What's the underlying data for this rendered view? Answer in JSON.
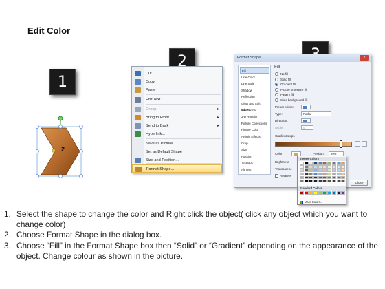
{
  "title": "Edit Color",
  "badges": [
    "1",
    "2",
    "3"
  ],
  "shape": {
    "label": "2",
    "fill": "#b4692b"
  },
  "context_menu": {
    "items": [
      {
        "label": "Cut",
        "icon": "scissors-icon",
        "color": "#3d6fb4",
        "arrow": "",
        "disabled": false,
        "highlight": false
      },
      {
        "label": "Copy",
        "icon": "copy-icon",
        "color": "#5d87c4",
        "arrow": "",
        "disabled": false,
        "highlight": false
      },
      {
        "label": "Paste",
        "icon": "paste-icon",
        "color": "#c99a3a",
        "arrow": "",
        "disabled": false,
        "highlight": false
      },
      {
        "label": "Edit Text",
        "icon": "edit-text-icon",
        "color": "#6b7e96",
        "arrow": "",
        "disabled": false,
        "highlight": false
      },
      {
        "label": "Group",
        "icon": "group-icon",
        "color": "#9aa6b6",
        "arrow": "▸",
        "disabled": true,
        "highlight": false
      },
      {
        "label": "Bring to Front",
        "icon": "bring-front-icon",
        "color": "#d08a2c",
        "arrow": "▸",
        "disabled": false,
        "highlight": false
      },
      {
        "label": "Send to Back",
        "icon": "send-back-icon",
        "color": "#7c94b8",
        "arrow": "▸",
        "disabled": false,
        "highlight": false
      },
      {
        "label": "Hyperlink...",
        "icon": "hyperlink-icon",
        "color": "#3f8a4e",
        "arrow": "",
        "disabled": false,
        "highlight": false
      },
      {
        "label": "Save as Picture...",
        "icon": "",
        "color": "",
        "arrow": "",
        "disabled": false,
        "highlight": false
      },
      {
        "label": "Set as Default Shape",
        "icon": "",
        "color": "",
        "arrow": "",
        "disabled": false,
        "highlight": false
      },
      {
        "label": "Size and Position...",
        "icon": "size-position-icon",
        "color": "#5b7fb3",
        "arrow": "",
        "disabled": false,
        "highlight": false
      },
      {
        "label": "Format Shape...",
        "icon": "format-shape-icon",
        "color": "#c0852f",
        "arrow": "",
        "disabled": false,
        "highlight": true
      }
    ]
  },
  "dialog": {
    "title": "Format Shape",
    "close_glyph": "x",
    "sidebar": [
      "Fill",
      "Line Color",
      "Line Style",
      "Shadow",
      "Reflection",
      "Glow and Soft Edges",
      "3-D Format",
      "3-D Rotation",
      "Picture Corrections",
      "Picture Color",
      "Artistic Effects",
      "Crop",
      "Size",
      "Position",
      "Text Box",
      "Alt Text"
    ],
    "fill_heading": "Fill",
    "fill_options": [
      "No fill",
      "Solid fill",
      "Gradient fill",
      "Picture or texture fill",
      "Pattern fill",
      "Slide background fill"
    ],
    "selected_option": 2,
    "preset_label": "Preset colors:",
    "type_label": "Type:",
    "type_value": "Radial",
    "direction_label": "Direction:",
    "angle_label": "Angle:",
    "angle_value": "0°",
    "stops_label": "Gradient stops",
    "color_label": "Color",
    "position_label": "Position:",
    "position_value": "89%",
    "brightness_label": "Brightness",
    "transparency_label": "Transparenc",
    "rotate_label": "Rotate w",
    "theme_colors_label": "Theme Colors",
    "standard_colors_label": "Standard Colors",
    "more_colors_label": "More Colors...",
    "close_button": "Close",
    "theme_colors": [
      "#ffffff",
      "#000000",
      "#eeece1",
      "#1f497d",
      "#4f81bd",
      "#c0504d",
      "#9bbb59",
      "#8064a2",
      "#4bacc6",
      "#f79646",
      "#f2f2f2",
      "#7f7f7f",
      "#ddd9c3",
      "#c6d9f0",
      "#dbe5f1",
      "#f2dcdb",
      "#ebf1dd",
      "#e5e0ec",
      "#dbeef3",
      "#fdeada",
      "#d8d8d8",
      "#595959",
      "#c4bd97",
      "#8db3e2",
      "#b8cce4",
      "#e5b9b7",
      "#d7e3bc",
      "#ccc1d9",
      "#b7dde8",
      "#fbd5b5",
      "#bfbfbf",
      "#3f3f3f",
      "#938953",
      "#548dd4",
      "#95b3d7",
      "#d99694",
      "#c3d69b",
      "#b2a2c7",
      "#92cddc",
      "#fac08f",
      "#a5a5a5",
      "#262626",
      "#494429",
      "#17365d",
      "#366092",
      "#953734",
      "#76923c",
      "#5f497a",
      "#31859b",
      "#e36c09",
      "#7f7f7f",
      "#0c0c0c",
      "#1d1b10",
      "#0f243e",
      "#244061",
      "#632423",
      "#4f6128",
      "#3f3151",
      "#205867",
      "#974806"
    ],
    "standard_colors": [
      "#c00000",
      "#ff0000",
      "#ffc000",
      "#ffff00",
      "#92d050",
      "#00b050",
      "#00b0f0",
      "#0070c0",
      "#002060",
      "#7030a0"
    ]
  },
  "instructions": [
    {
      "num": "1.",
      "text": "Select the shape to change the color and Right click the object( click any object which you want to change color)"
    },
    {
      "num": "2.",
      "text": "Choose Format Shape in the dialog box."
    },
    {
      "num": "3.",
      "text": "Choose “Fill” in the Format Shape box then “Solid” or “Gradient” depending on the appearance of the object. Change colour as shown in the picture."
    }
  ]
}
